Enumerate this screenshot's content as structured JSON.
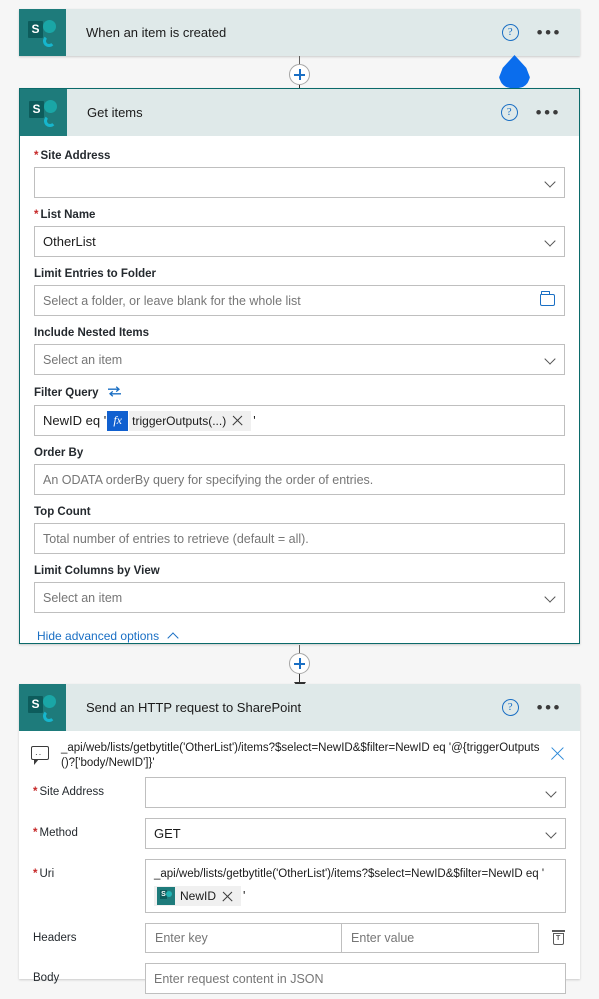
{
  "flow": {
    "trigger": {
      "title": "When an item is created",
      "icon": "sharepoint-icon",
      "help_label": "?",
      "more_label": "•••"
    },
    "action_get_items": {
      "title": "Get items",
      "help_label": "?",
      "more_label": "•••",
      "fields": {
        "site_address": {
          "label": "Site Address",
          "required": true,
          "value": "",
          "placeholder": ""
        },
        "list_name": {
          "label": "List Name",
          "required": true,
          "value": "OtherList",
          "placeholder": ""
        },
        "limit_entries_to_folder": {
          "label": "Limit Entries to Folder",
          "required": false,
          "value": "",
          "placeholder": "Select a folder, or leave blank for the whole list"
        },
        "include_nested_items": {
          "label": "Include Nested Items",
          "required": false,
          "value": "",
          "placeholder": "Select an item"
        },
        "filter_query": {
          "label": "Filter Query",
          "required": false,
          "swap_icon": "swap-arrows-icon",
          "prefix_text": "NewID eq '",
          "token_fx_label": "fx",
          "token_text": "triggerOutputs(...)",
          "token_remove_label": "×",
          "suffix_text": "'"
        },
        "order_by": {
          "label": "Order By",
          "required": false,
          "value": "",
          "placeholder": "An ODATA orderBy query for specifying the order of entries."
        },
        "top_count": {
          "label": "Top Count",
          "required": false,
          "value": "",
          "placeholder": "Total number of entries to retrieve (default = all)."
        },
        "limit_columns_by_view": {
          "label": "Limit Columns by View",
          "required": false,
          "value": "",
          "placeholder": "Select an item"
        }
      },
      "advanced_toggle": "Hide advanced options"
    },
    "action_http": {
      "title": "Send an HTTP request to SharePoint",
      "help_label": "?",
      "more_label": "•••",
      "comment": "_api/web/lists/getbytitle('OtherList')/items?$select=NewID&$filter=NewID eq '@{triggerOutputs()?['body/NewID']}'",
      "comment_close_label": "×",
      "fields": {
        "site_address": {
          "label": "Site Address",
          "required": true,
          "value": "",
          "placeholder": ""
        },
        "method": {
          "label": "Method",
          "required": true,
          "value": "GET",
          "placeholder": ""
        },
        "uri": {
          "label": "Uri",
          "required": true,
          "text": "_api/web/lists/getbytitle('OtherList')/items?$select=NewID&$filter=NewID eq '",
          "token_text": "NewID",
          "token_icon": "sharepoint-icon",
          "token_remove_label": "×",
          "suffix_text": "'"
        },
        "headers": {
          "label": "Headers",
          "key_placeholder": "Enter key",
          "value_placeholder": "Enter value",
          "delete_label": "delete"
        },
        "body": {
          "label": "Body",
          "placeholder": "Enter request content in JSON"
        }
      }
    },
    "connectors": {
      "insert_label": "+"
    },
    "colors": {
      "card_header_bg": "#dfe9e9",
      "sharepoint_teal": "#1e7b7b",
      "accent_blue": "#1a6fc4",
      "droplet_blue": "#0a6ded",
      "required_red": "#c62828",
      "canvas_bg": "#f6f6f6",
      "selected_border": "#0b6a6a"
    }
  }
}
